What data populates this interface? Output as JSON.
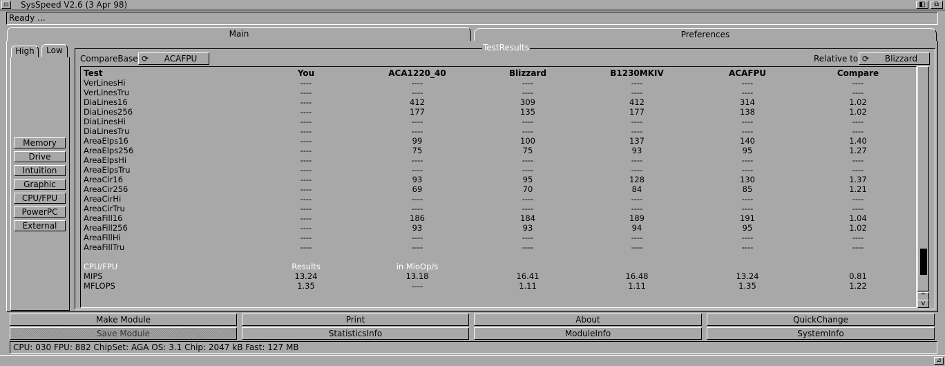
{
  "window": {
    "title": "SysSpeed  V2.6 (3 Apr 98)",
    "close_glyph": "▫",
    "depth_glyph": "◧",
    "zoom_glyph": "⧉"
  },
  "status": {
    "text": "Ready ..."
  },
  "tabs": {
    "main": "Main",
    "preferences": "Preferences"
  },
  "subtabs": {
    "high": "High",
    "low": "Low"
  },
  "categories": [
    "Memory",
    "Drive",
    "Intuition",
    "Graphic",
    "CPU/FPU",
    "PowerPC",
    "External"
  ],
  "group": {
    "title": "TestResults",
    "comparebase_label": "CompareBase",
    "comparebase_value": "ACAFPU",
    "relative_label": "Relative to",
    "relative_value": "Blizzard"
  },
  "table": {
    "headers": [
      "Test",
      "You",
      "ACA1220_40",
      "Blizzard",
      "B1230MKIV",
      "ACAFPU",
      "Compare"
    ],
    "rows": [
      [
        "VerLinesHi",
        "----",
        "----",
        "----",
        "----",
        "----",
        "----"
      ],
      [
        "VerLinesTru",
        "----",
        "----",
        "----",
        "----",
        "----",
        "----"
      ],
      [
        "DiaLines16",
        "----",
        "412",
        "309",
        "412",
        "314",
        "1.02"
      ],
      [
        "DiaLines256",
        "----",
        "177",
        "135",
        "177",
        "138",
        "1.02"
      ],
      [
        "DiaLinesHi",
        "----",
        "----",
        "----",
        "----",
        "----",
        "----"
      ],
      [
        "DiaLinesTru",
        "----",
        "----",
        "----",
        "----",
        "----",
        "----"
      ],
      [
        "AreaElps16",
        "----",
        "99",
        "100",
        "137",
        "140",
        "1.40"
      ],
      [
        "AreaElps256",
        "----",
        "75",
        "75",
        "93",
        "95",
        "1.27"
      ],
      [
        "AreaElpsHi",
        "----",
        "----",
        "----",
        "----",
        "----",
        "----"
      ],
      [
        "AreaElpsTru",
        "----",
        "----",
        "----",
        "----",
        "----",
        "----"
      ],
      [
        "AreaCir16",
        "----",
        "93",
        "95",
        "128",
        "130",
        "1.37"
      ],
      [
        "AreaCir256",
        "----",
        "69",
        "70",
        "84",
        "85",
        "1.21"
      ],
      [
        "AreaCirHi",
        "----",
        "----",
        "----",
        "----",
        "----",
        "----"
      ],
      [
        "AreaCirTru",
        "----",
        "----",
        "----",
        "----",
        "----",
        "----"
      ],
      [
        "AreaFill16",
        "----",
        "186",
        "184",
        "189",
        "191",
        "1.04"
      ],
      [
        "AreaFill256",
        "----",
        "93",
        "93",
        "94",
        "95",
        "1.02"
      ],
      [
        "AreaFillHi",
        "----",
        "----",
        "----",
        "----",
        "----",
        "----"
      ],
      [
        "AreaFillTru",
        "----",
        "----",
        "----",
        "----",
        "----",
        "----"
      ]
    ],
    "section": {
      "label": "CPU/FPU",
      "results": "Results",
      "unit": "in MioOp/s"
    },
    "cpu_rows": [
      [
        "MIPS",
        "13.24",
        "13.18",
        "16.41",
        "16.48",
        "13.24",
        "0.81"
      ],
      [
        "MFLOPS",
        "1.35",
        "----",
        "1.11",
        "1.11",
        "1.35",
        "1.22"
      ]
    ]
  },
  "scroll": {
    "up_glyph": "^",
    "down_glyph": "v",
    "position": 0.85
  },
  "buttons": {
    "make_module": "Make Module",
    "print": "Print",
    "about": "About",
    "quickchange": "QuickChange",
    "save_module": "Save Module",
    "statisticsinfo": "StatisticsInfo",
    "moduleinfo": "ModuleInfo",
    "systeminfo": "SystemInfo"
  },
  "sysinfo": {
    "text": "CPU: 030  FPU: 882  ChipSet: AGA  OS: 3.1  Chip: 2047 kB  Fast: 127 MB"
  },
  "cycle_glyph": "⟳"
}
